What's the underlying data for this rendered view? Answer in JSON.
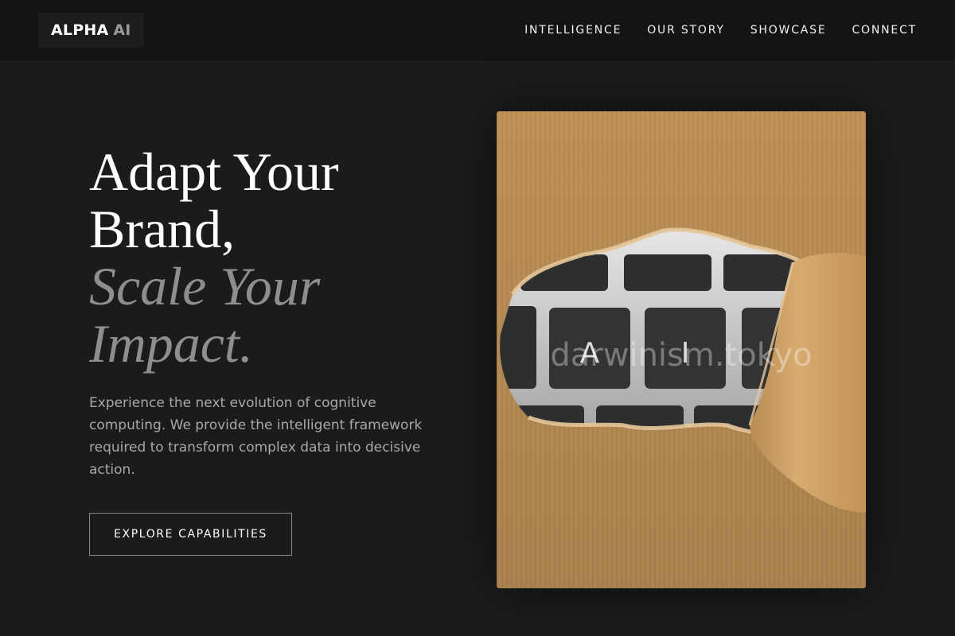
{
  "header": {
    "logo": {
      "primary": "ALPHA",
      "secondary": "AI"
    },
    "nav": [
      "INTELLIGENCE",
      "OUR STORY",
      "SHOWCASE",
      "CONNECT"
    ]
  },
  "hero": {
    "title_lines": [
      "Adapt Your",
      "Brand,",
      "Scale Your",
      "Impact."
    ],
    "description": "Experience the next evolution of cognitive computing. We provide the intelligent framework required to transform complex data into decisive action.",
    "cta_label": "EXPLORE CAPABILITIES"
  },
  "image": {
    "keys": [
      "A",
      "I"
    ],
    "watermark": "darwinism.tokyo"
  },
  "colors": {
    "background": "#1b1b1b",
    "header": "#141414",
    "muted_heading": "#8e8e8e",
    "body_text": "#a8a8a8",
    "paper": "#c99a5e"
  }
}
